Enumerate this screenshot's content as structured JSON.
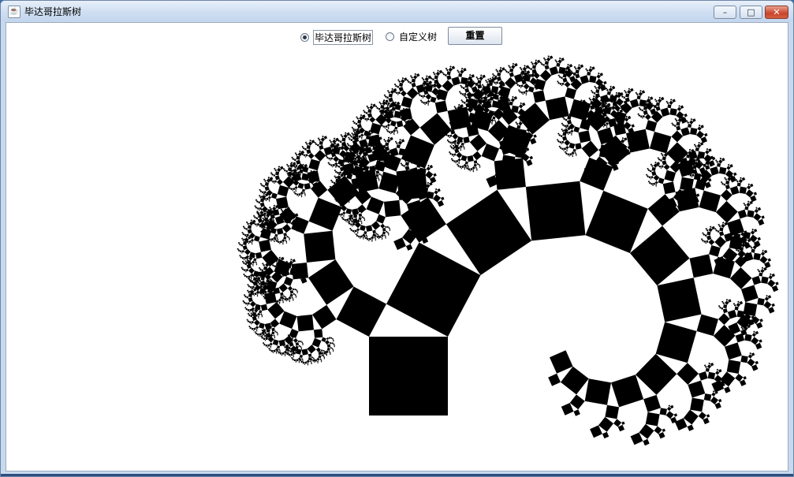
{
  "window": {
    "title": "毕达哥拉斯树",
    "buttons": {
      "minimize": "–",
      "maximize": "□",
      "close": "✕"
    }
  },
  "controls": {
    "options": [
      {
        "label": "毕达哥拉斯树",
        "checked": true
      },
      {
        "label": "自定义树",
        "checked": false
      }
    ],
    "reset_label": "重置"
  },
  "fractal": {
    "fill_color": "#000000",
    "background": "#ffffff"
  }
}
